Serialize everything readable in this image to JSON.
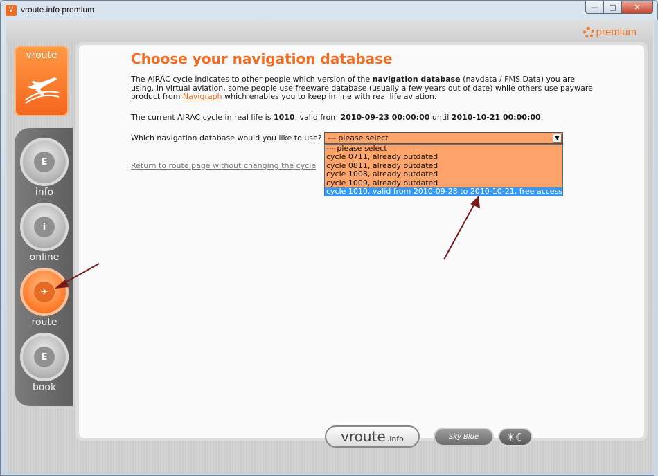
{
  "window": {
    "title": "vroute.info premium",
    "app_icon": "V",
    "controls": {
      "minimize": "—",
      "maximize": "□",
      "close": "✕"
    }
  },
  "header": {
    "premium_label": "premium",
    "premium_icon": "gear-icon",
    "accent": "#f07628"
  },
  "sidebar": {
    "brand_label": "vroute",
    "items": [
      {
        "label": "info",
        "icon_glyph": "E",
        "active": false
      },
      {
        "label": "online",
        "icon_glyph": "i",
        "active": false
      },
      {
        "label": "route",
        "icon_glyph": "✈",
        "active": true
      },
      {
        "label": "book",
        "icon_glyph": "E",
        "active": false
      }
    ]
  },
  "main": {
    "title": "Choose your navigation database",
    "intro_1": "The AIRAC cycle indicates to other people which version of the ",
    "intro_bold": "navigation database",
    "intro_2": " (navdata / FMS Data) you are using. In virtual aviation, some people use freeware database (usually a few years out of date) while others use payware product from ",
    "intro_link": "Navigraph",
    "intro_3": " which enables you to keep in line with real life aviation.",
    "airac_prefix": "The current AIRAC cycle in real life is ",
    "airac_cycle": "1010",
    "airac_mid": ", valid from ",
    "airac_from": "2010-09-23 00:00:00",
    "airac_until_label": " until ",
    "airac_until": "2010-10-21 00:00:00",
    "airac_end": ".",
    "question": "Which navigation database would you like to use?",
    "select_value": "--- please select",
    "options": [
      "--- please select",
      "cycle 0711, already outdated",
      "cycle 0811, already outdated",
      "cycle 1008, already outdated",
      "cycle 1009, already outdated",
      "cycle 1010, valid from 2010-09-23 to 2010-10-21, free access"
    ],
    "highlighted_option_index": 5,
    "return_link": "Return to route page without changing the cycle"
  },
  "footer": {
    "vroute_main": "vroute",
    "vroute_suffix": ".info",
    "sky_label": "Sky Blue",
    "theme_icons": "☀☾"
  }
}
